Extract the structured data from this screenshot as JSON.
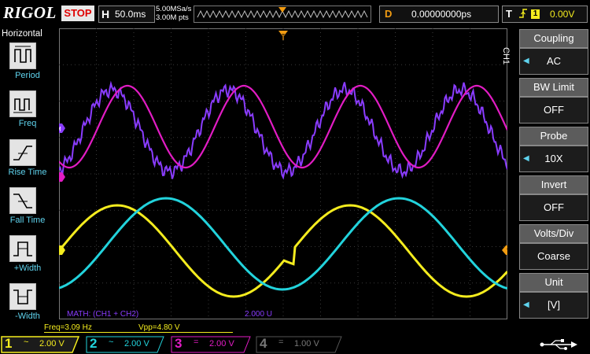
{
  "topbar": {
    "logo": "RIGOL",
    "run_state": "STOP",
    "horizontal_letter": "H",
    "timebase": "50.0ms",
    "sample_rate": "5.00MSa/s",
    "memory_depth": "3.00M pts",
    "delay_letter": "D",
    "delay_value": "0.00000000ps",
    "trigger_letter": "T",
    "trigger_edge_icon": "rising-edge-icon",
    "trigger_source": "1",
    "trigger_level": "0.00V"
  },
  "left_menu": {
    "title": "Horizontal",
    "items": [
      {
        "label": "Period",
        "icon": "period-icon"
      },
      {
        "label": "Freq",
        "icon": "freq-icon"
      },
      {
        "label": "Rise Time",
        "icon": "rise-time-icon"
      },
      {
        "label": "Fall Time",
        "icon": "fall-time-icon"
      },
      {
        "label": "+Width",
        "icon": "positive-width-icon"
      },
      {
        "label": "-Width",
        "icon": "negative-width-icon"
      }
    ]
  },
  "right_menu": {
    "channel": "CH1",
    "items": [
      {
        "label": "Coupling",
        "value": "AC",
        "has_arrow": true
      },
      {
        "label": "BW Limit",
        "value": "OFF",
        "has_arrow": false
      },
      {
        "label": "Probe",
        "value": "10X",
        "has_arrow": true
      },
      {
        "label": "Invert",
        "value": "OFF",
        "has_arrow": false
      },
      {
        "label": "Volts/Div",
        "value": "Coarse",
        "has_arrow": false
      },
      {
        "label": "Unit",
        "value": "[V]",
        "has_arrow": true
      }
    ]
  },
  "screen": {
    "math_label": "MATH: (CH1 + CH2)",
    "math_scale": "2.000 U",
    "markers": {
      "math": "M",
      "ch3": "3",
      "ch1": "1",
      "trigger_level": "T"
    }
  },
  "measurements": {
    "freq": "Freq=3.09 Hz",
    "vpp": "Vpp=4.80 V"
  },
  "channels": [
    {
      "num": "1",
      "coupling": "~",
      "scale": "2.00 V",
      "color": "#f4ec1e",
      "active": true
    },
    {
      "num": "2",
      "coupling": "~",
      "scale": "2.00 V",
      "color": "#22d3dc",
      "active": false
    },
    {
      "num": "3",
      "coupling": "=",
      "scale": "2.00 V",
      "color": "#e21cc4",
      "active": false
    },
    {
      "num": "4",
      "coupling": "=",
      "scale": "1.00 V",
      "color": "#777777",
      "active": false
    }
  ],
  "colors": {
    "ch1": "#f4ec1e",
    "ch2": "#22d3dc",
    "ch3": "#e21cc4",
    "math": "#8a3cff",
    "accent": "#f29c12",
    "menu_label": "#5fd3ee"
  },
  "status": {
    "usb_icon": "usb-icon"
  }
}
